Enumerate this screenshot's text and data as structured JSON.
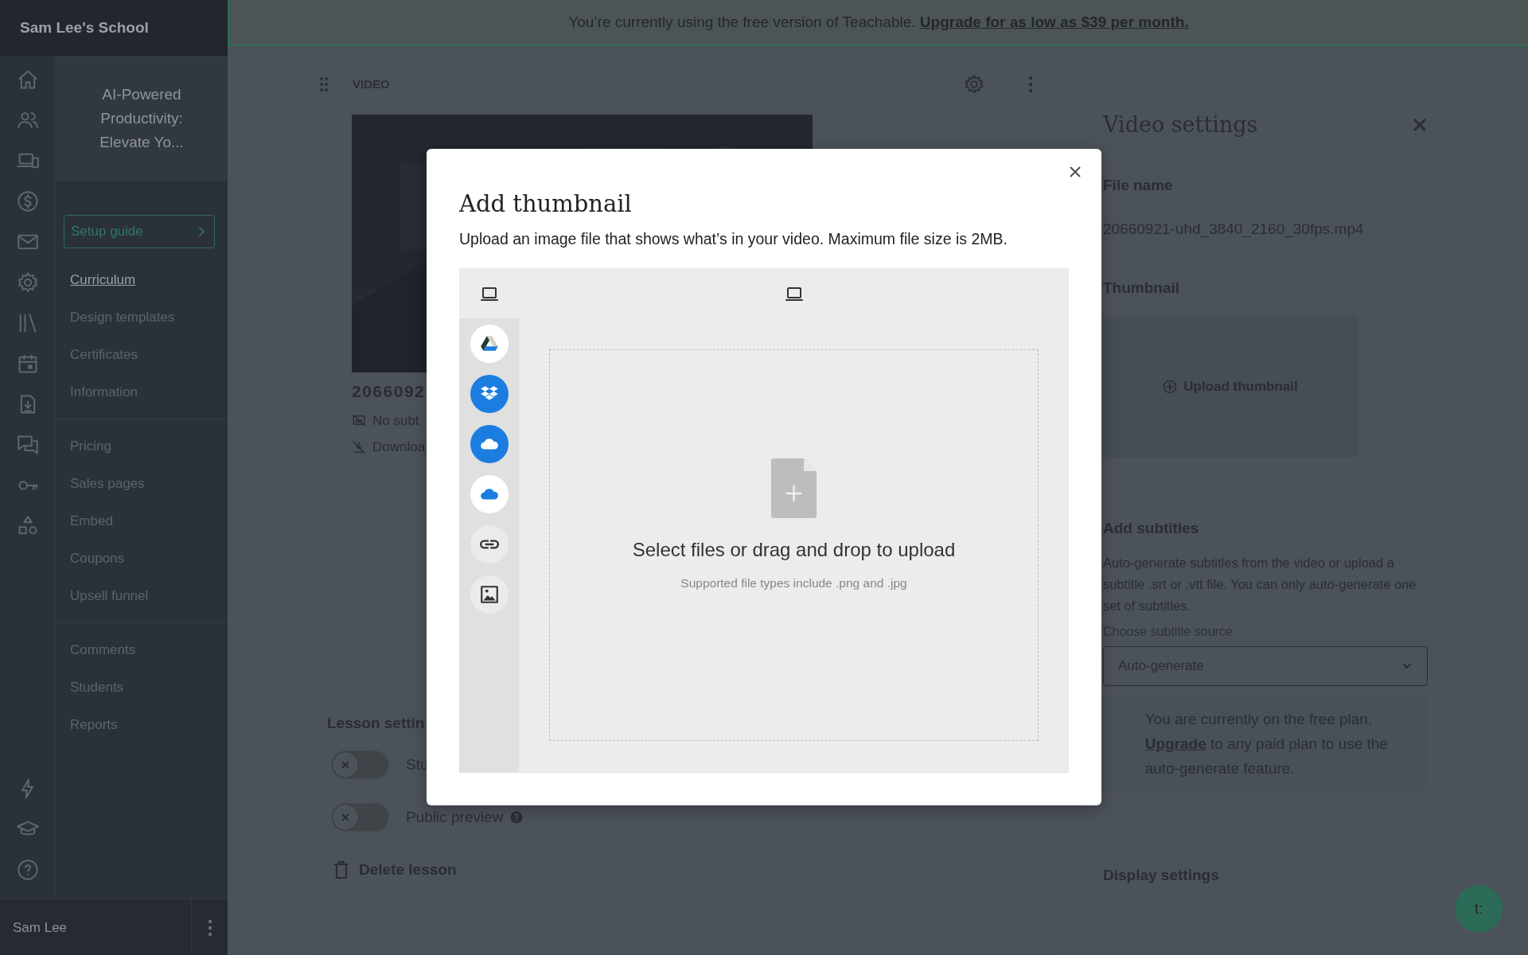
{
  "banner": {
    "text": "You’re currently using the free version of Teachable.",
    "link": "Upgrade for as low as $39 per month."
  },
  "sidebar": {
    "school": "Sam Lee's School",
    "course_title": "AI-Powered Productivity: Elevate Yo...",
    "setup_guide": "Setup guide",
    "nav_groups": [
      [
        {
          "label": "Curriculum",
          "selected": true
        },
        {
          "label": "Design templates",
          "selected": false
        },
        {
          "label": "Certificates",
          "selected": false
        },
        {
          "label": "Information",
          "selected": false
        }
      ],
      [
        {
          "label": "Pricing",
          "selected": false
        },
        {
          "label": "Sales pages",
          "selected": false
        },
        {
          "label": "Embed",
          "selected": false
        },
        {
          "label": "Coupons",
          "selected": false
        },
        {
          "label": "Upsell funnel",
          "selected": false
        }
      ],
      [
        {
          "label": "Comments",
          "selected": false
        },
        {
          "label": "Students",
          "selected": false
        },
        {
          "label": "Reports",
          "selected": false
        }
      ]
    ],
    "user": "Sam Lee"
  },
  "lesson": {
    "section": "VIDEO",
    "file_title": "2066092",
    "meta": [
      "No subt",
      "Downloa"
    ],
    "settings_title": "Lesson settin",
    "toggles": [
      {
        "label": "Stu",
        "on": false,
        "help": false
      },
      {
        "label": "Public preview",
        "on": false,
        "help": true
      }
    ],
    "delete": "Delete lesson"
  },
  "modal": {
    "title": "Add thumbnail",
    "description": "Upload an image file that shows what’s in your video. Maximum file size is 2MB.",
    "prompt": "Select files or drag and drop to upload",
    "hint": "Supported file types include .png and .jpg"
  },
  "settings_panel": {
    "title": "Video settings",
    "file_name_label": "File name",
    "file_name": "20660921-uhd_3840_2160_30fps.mp4",
    "thumbnail_label": "Thumbnail",
    "upload_thumbnail": "Upload thumbnail",
    "subtitles_title": "Add subtitles",
    "subtitles_text": "Auto-generate subtitles from the video or upload a subtitle .srt or .vtt file. You can only auto-generate one set of subtitles.",
    "source_label": "Choose subtitle source",
    "source_value": "Auto-generate",
    "notice_before": "You are currently on the free plan.",
    "notice_link": "Upgrade",
    "notice_after": "to any paid plan to use the auto-generate feature.",
    "display_title": "Display settings"
  },
  "chat_button": "t:"
}
